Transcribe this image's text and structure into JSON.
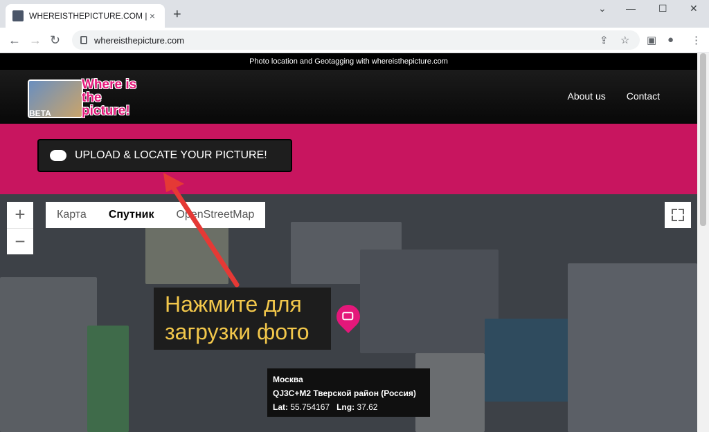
{
  "browser": {
    "tab_title": "WHEREISTHEPICTURE.COM | Pho",
    "tab_close": "×",
    "new_tab": "+",
    "url": "whereisthepicture.com",
    "window_controls": [
      "⌄",
      "—",
      "☐",
      "✕"
    ]
  },
  "site": {
    "top_bar_text": "Photo location and Geotagging with whereisthepicture.com",
    "logo_text": "Where is the picture!",
    "logo_beta": "BETA",
    "nav": {
      "about": "About us",
      "contact": "Contact"
    },
    "upload_label": "UPLOAD & LOCATE YOUR PICTURE!"
  },
  "map": {
    "zoom_in": "+",
    "zoom_out": "−",
    "map_types": [
      "Карта",
      "Спутник",
      "OpenStreetMap"
    ],
    "active_type": "Спутник",
    "hint_text": "Нажмите для загрузки фото",
    "info": {
      "city": "Москва",
      "plus_code": "QJ3C+M2 Тверской район (Россия)",
      "lat_label": "Lat:",
      "lat": "55.754167",
      "lng_label": "Lng:",
      "lng": "37.62"
    }
  },
  "colors": {
    "brand_pink": "#c8155f",
    "hint_text": "#f2c74b",
    "pin": "#e4177a"
  }
}
